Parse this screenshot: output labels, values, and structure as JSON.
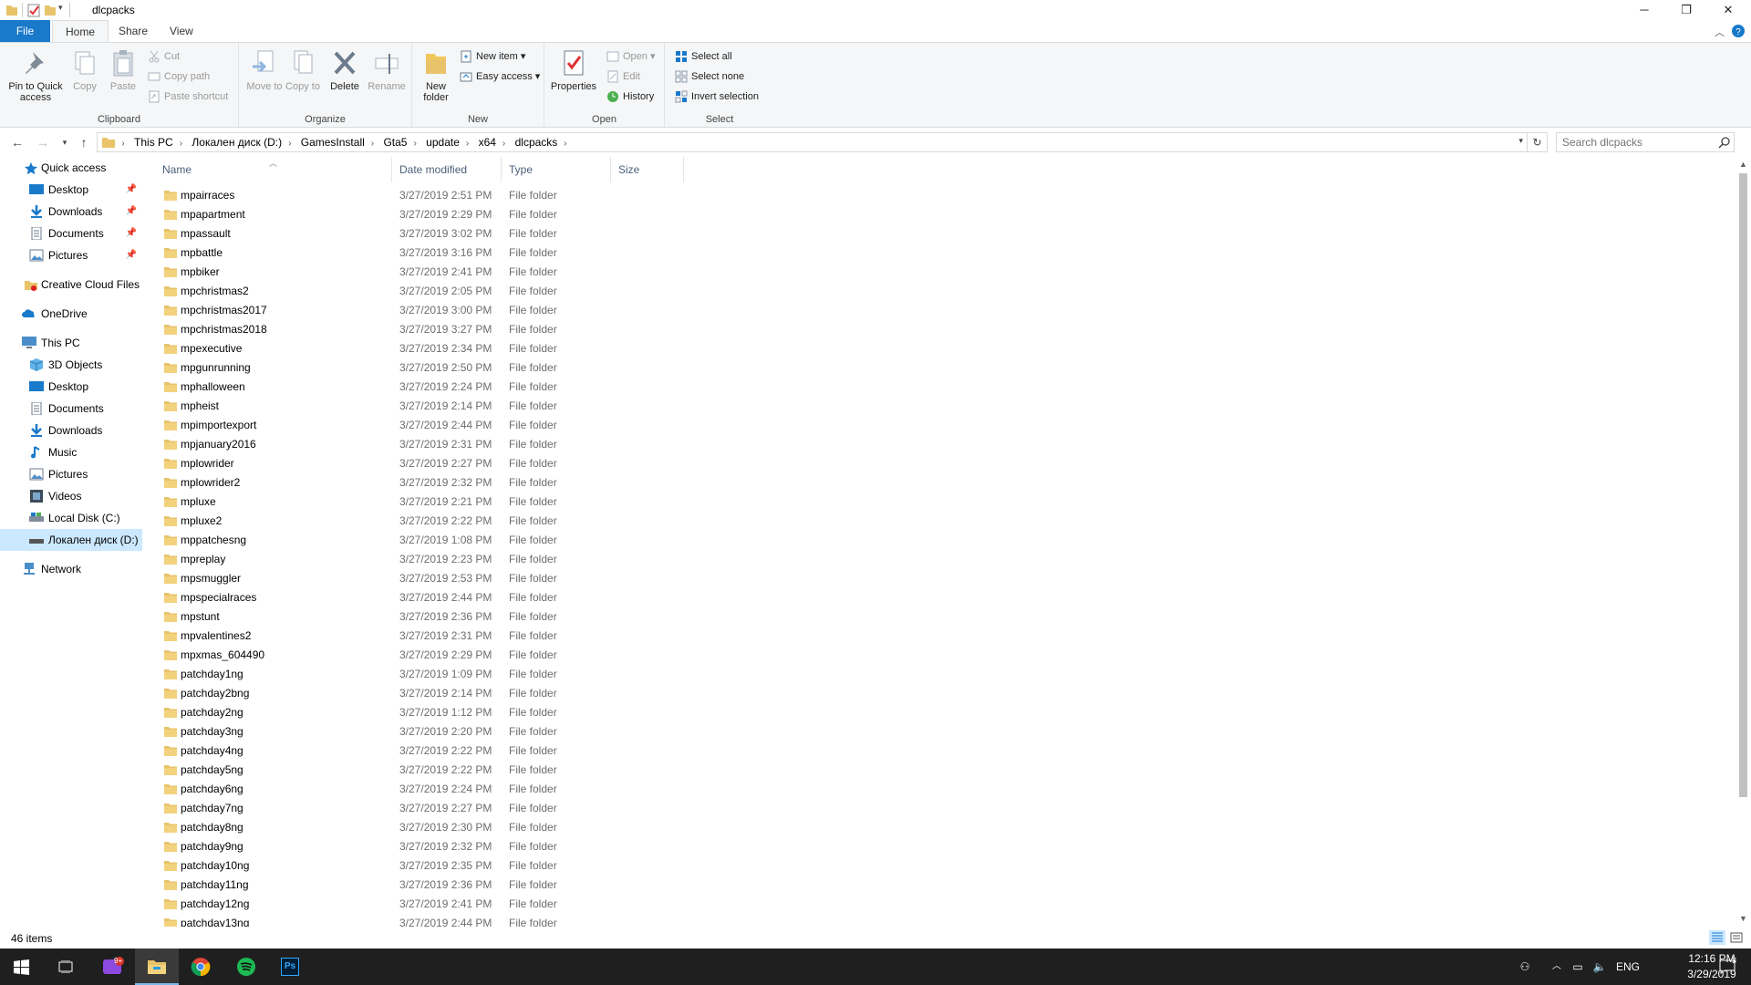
{
  "window": {
    "title": "dlcpacks",
    "controls": {
      "minimize": "─",
      "restore": "❐",
      "close": "✕"
    }
  },
  "ribbon": {
    "tabs": [
      "File",
      "Home",
      "Share",
      "View"
    ],
    "clipboard": {
      "label": "Clipboard",
      "pin": "Pin to Quick access",
      "copy": "Copy",
      "paste": "Paste",
      "cut": "Cut",
      "copy_path": "Copy path",
      "paste_shortcut": "Paste shortcut"
    },
    "organize": {
      "label": "Organize",
      "move_to": "Move to",
      "copy_to": "Copy to",
      "delete": "Delete",
      "rename": "Rename"
    },
    "new": {
      "label": "New",
      "new_folder": "New folder",
      "new_item": "New item",
      "easy_access": "Easy access"
    },
    "open": {
      "label": "Open",
      "properties": "Properties",
      "open": "Open",
      "edit": "Edit",
      "history": "History"
    },
    "select": {
      "label": "Select",
      "select_all": "Select all",
      "select_none": "Select none",
      "invert_selection": "Invert selection"
    }
  },
  "address": {
    "crumbs": [
      "This PC",
      "Локален диск (D:)",
      "GamesInstall",
      "Gta5",
      "update",
      "x64",
      "dlcpacks"
    ],
    "search_placeholder": "Search dlcpacks"
  },
  "nav": {
    "quick_access": "Quick access",
    "quick_items": [
      "Desktop",
      "Downloads",
      "Documents",
      "Pictures"
    ],
    "creative_cloud": "Creative Cloud Files",
    "onedrive": "OneDrive",
    "this_pc": "This PC",
    "pc_items": [
      "3D Objects",
      "Desktop",
      "Documents",
      "Downloads",
      "Music",
      "Pictures",
      "Videos",
      "Local Disk (C:)",
      "Локален диск (D:)"
    ],
    "network": "Network"
  },
  "columns": {
    "name": "Name",
    "date": "Date modified",
    "type": "Type",
    "size": "Size"
  },
  "files": [
    {
      "name": "mpairraces",
      "date": "3/27/2019 2:51 PM",
      "type": "File folder"
    },
    {
      "name": "mpapartment",
      "date": "3/27/2019 2:29 PM",
      "type": "File folder"
    },
    {
      "name": "mpassault",
      "date": "3/27/2019 3:02 PM",
      "type": "File folder"
    },
    {
      "name": "mpbattle",
      "date": "3/27/2019 3:16 PM",
      "type": "File folder"
    },
    {
      "name": "mpbiker",
      "date": "3/27/2019 2:41 PM",
      "type": "File folder"
    },
    {
      "name": "mpchristmas2",
      "date": "3/27/2019 2:05 PM",
      "type": "File folder"
    },
    {
      "name": "mpchristmas2017",
      "date": "3/27/2019 3:00 PM",
      "type": "File folder"
    },
    {
      "name": "mpchristmas2018",
      "date": "3/27/2019 3:27 PM",
      "type": "File folder"
    },
    {
      "name": "mpexecutive",
      "date": "3/27/2019 2:34 PM",
      "type": "File folder"
    },
    {
      "name": "mpgunrunning",
      "date": "3/27/2019 2:50 PM",
      "type": "File folder"
    },
    {
      "name": "mphalloween",
      "date": "3/27/2019 2:24 PM",
      "type": "File folder"
    },
    {
      "name": "mpheist",
      "date": "3/27/2019 2:14 PM",
      "type": "File folder"
    },
    {
      "name": "mpimportexport",
      "date": "3/27/2019 2:44 PM",
      "type": "File folder"
    },
    {
      "name": "mpjanuary2016",
      "date": "3/27/2019 2:31 PM",
      "type": "File folder"
    },
    {
      "name": "mplowrider",
      "date": "3/27/2019 2:27 PM",
      "type": "File folder"
    },
    {
      "name": "mplowrider2",
      "date": "3/27/2019 2:32 PM",
      "type": "File folder"
    },
    {
      "name": "mpluxe",
      "date": "3/27/2019 2:21 PM",
      "type": "File folder"
    },
    {
      "name": "mpluxe2",
      "date": "3/27/2019 2:22 PM",
      "type": "File folder"
    },
    {
      "name": "mppatchesng",
      "date": "3/27/2019 1:08 PM",
      "type": "File folder"
    },
    {
      "name": "mpreplay",
      "date": "3/27/2019 2:23 PM",
      "type": "File folder"
    },
    {
      "name": "mpsmuggler",
      "date": "3/27/2019 2:53 PM",
      "type": "File folder"
    },
    {
      "name": "mpspecialraces",
      "date": "3/27/2019 2:44 PM",
      "type": "File folder"
    },
    {
      "name": "mpstunt",
      "date": "3/27/2019 2:36 PM",
      "type": "File folder"
    },
    {
      "name": "mpvalentines2",
      "date": "3/27/2019 2:31 PM",
      "type": "File folder"
    },
    {
      "name": "mpxmas_604490",
      "date": "3/27/2019 2:29 PM",
      "type": "File folder"
    },
    {
      "name": "patchday1ng",
      "date": "3/27/2019 1:09 PM",
      "type": "File folder"
    },
    {
      "name": "patchday2bng",
      "date": "3/27/2019 2:14 PM",
      "type": "File folder"
    },
    {
      "name": "patchday2ng",
      "date": "3/27/2019 1:12 PM",
      "type": "File folder"
    },
    {
      "name": "patchday3ng",
      "date": "3/27/2019 2:20 PM",
      "type": "File folder"
    },
    {
      "name": "patchday4ng",
      "date": "3/27/2019 2:22 PM",
      "type": "File folder"
    },
    {
      "name": "patchday5ng",
      "date": "3/27/2019 2:22 PM",
      "type": "File folder"
    },
    {
      "name": "patchday6ng",
      "date": "3/27/2019 2:24 PM",
      "type": "File folder"
    },
    {
      "name": "patchday7ng",
      "date": "3/27/2019 2:27 PM",
      "type": "File folder"
    },
    {
      "name": "patchday8ng",
      "date": "3/27/2019 2:30 PM",
      "type": "File folder"
    },
    {
      "name": "patchday9ng",
      "date": "3/27/2019 2:32 PM",
      "type": "File folder"
    },
    {
      "name": "patchday10ng",
      "date": "3/27/2019 2:35 PM",
      "type": "File folder"
    },
    {
      "name": "patchday11ng",
      "date": "3/27/2019 2:36 PM",
      "type": "File folder"
    },
    {
      "name": "patchday12ng",
      "date": "3/27/2019 2:41 PM",
      "type": "File folder"
    },
    {
      "name": "patchday13ng",
      "date": "3/27/2019 2:44 PM",
      "type": "File folder"
    }
  ],
  "status": {
    "count": "46 items"
  },
  "taskbar": {
    "apps": [
      "start-icon",
      "task-view-icon",
      "game-app-icon",
      "file-explorer-icon",
      "chrome-icon",
      "spotify-icon",
      "photoshop-icon"
    ],
    "badge": "9+",
    "photoshop_label": "Ps",
    "language": "ENG",
    "time": "12:16 PM",
    "date": "3/29/2019",
    "notifications": "3"
  },
  "colors": {
    "accent": "#1979ca",
    "folder": "#e8c36a",
    "selected": "#cce8ff",
    "taskbar": "#1f1f1f"
  }
}
